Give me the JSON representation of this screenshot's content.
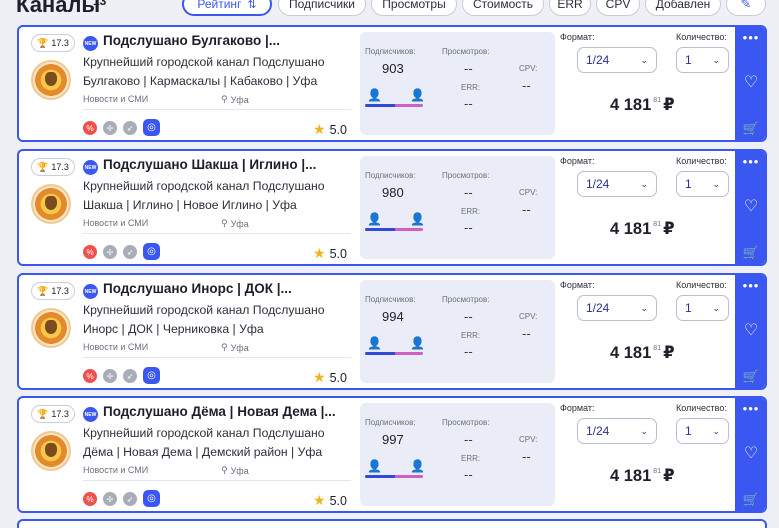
{
  "header": {
    "title": "Каналы",
    "count": "13",
    "sort_buttons": [
      {
        "label": "Рейтинг",
        "active": true,
        "icon": "sort-icon"
      },
      {
        "label": "Подписчики",
        "active": false
      },
      {
        "label": "Просмотры",
        "active": false
      },
      {
        "label": "Стоимость",
        "active": false
      },
      {
        "label": "ERR",
        "active": false
      },
      {
        "label": "CPV",
        "active": false
      },
      {
        "label": "Добавлен",
        "active": false
      }
    ],
    "extra_button_icon": "pencil-icon"
  },
  "labels": {
    "subscribers": "Подписчиков:",
    "views": "Просмотров:",
    "err": "ERR:",
    "cpv": "CPV:",
    "format": "Формат:",
    "quantity": "Количество:",
    "new_badge": "NEW",
    "currency": "₽"
  },
  "colors": {
    "accent": "#3a57f2",
    "male": "#2f4bd8",
    "female": "#d05fc4",
    "star": "#f2b21c",
    "danger": "#f0514d"
  },
  "channels": [
    {
      "rank": "17.3",
      "name": "Подслушано Булгаково |...",
      "description": "Крупнейший городской канал Подслушано Булгаково | Кармаскалы | Кабаково | Уфа",
      "category": "Новости и СМИ",
      "city": "Уфа",
      "rating": "5.0",
      "subscribers": "903",
      "views": "--",
      "err": "--",
      "cpv": "--",
      "format": "1/24",
      "quantity": "1",
      "price_main": "4 181",
      "price_cents": "81"
    },
    {
      "rank": "17.3",
      "name": "Подслушано Шакша | Иглино |...",
      "description": "Крупнейший городской канал Подслушано Шакша | Иглино | Новое Иглино | Уфа",
      "category": "Новости и СМИ",
      "city": "Уфа",
      "rating": "5.0",
      "subscribers": "980",
      "views": "--",
      "err": "--",
      "cpv": "--",
      "format": "1/24",
      "quantity": "1",
      "price_main": "4 181",
      "price_cents": "81"
    },
    {
      "rank": "17.3",
      "name": "Подслушано Инорс | ДОК |...",
      "description": "Крупнейший городской канал Подслушано Инорс | ДОК | Черниковка | Уфа",
      "category": "Новости и СМИ",
      "city": "Уфа",
      "rating": "5.0",
      "subscribers": "994",
      "views": "--",
      "err": "--",
      "cpv": "--",
      "format": "1/24",
      "quantity": "1",
      "price_main": "4 181",
      "price_cents": "81"
    },
    {
      "rank": "17.3",
      "name": "Подслушано Дёма | Новая Дема |...",
      "description": "Крупнейший городской канал Подслушано Дёма | Новая Дема | Демский район | Уфа",
      "category": "Новости и СМИ",
      "city": "Уфа",
      "rating": "5.0",
      "subscribers": "997",
      "views": "--",
      "err": "--",
      "cpv": "--",
      "format": "1/24",
      "quantity": "1",
      "price_main": "4 181",
      "price_cents": "81"
    }
  ]
}
